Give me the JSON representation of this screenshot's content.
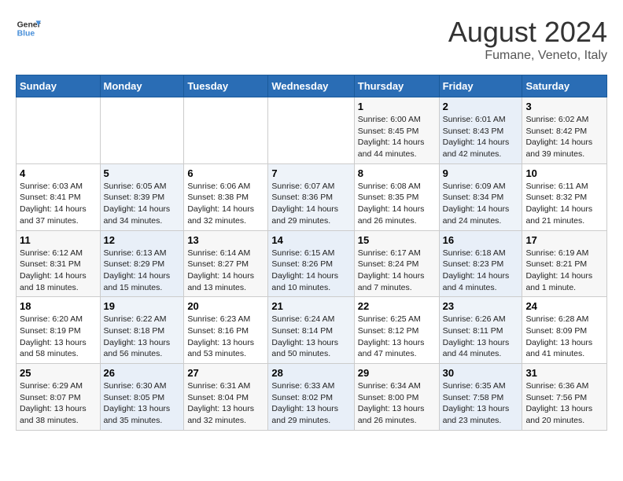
{
  "logo": {
    "text_general": "General",
    "text_blue": "Blue"
  },
  "title": "August 2024",
  "subtitle": "Fumane, Veneto, Italy",
  "header_days": [
    "Sunday",
    "Monday",
    "Tuesday",
    "Wednesday",
    "Thursday",
    "Friday",
    "Saturday"
  ],
  "weeks": [
    [
      {
        "day": "",
        "info": ""
      },
      {
        "day": "",
        "info": ""
      },
      {
        "day": "",
        "info": ""
      },
      {
        "day": "",
        "info": ""
      },
      {
        "day": "1",
        "info": "Sunrise: 6:00 AM\nSunset: 8:45 PM\nDaylight: 14 hours and 44 minutes."
      },
      {
        "day": "2",
        "info": "Sunrise: 6:01 AM\nSunset: 8:43 PM\nDaylight: 14 hours and 42 minutes."
      },
      {
        "day": "3",
        "info": "Sunrise: 6:02 AM\nSunset: 8:42 PM\nDaylight: 14 hours and 39 minutes."
      }
    ],
    [
      {
        "day": "4",
        "info": "Sunrise: 6:03 AM\nSunset: 8:41 PM\nDaylight: 14 hours and 37 minutes."
      },
      {
        "day": "5",
        "info": "Sunrise: 6:05 AM\nSunset: 8:39 PM\nDaylight: 14 hours and 34 minutes."
      },
      {
        "day": "6",
        "info": "Sunrise: 6:06 AM\nSunset: 8:38 PM\nDaylight: 14 hours and 32 minutes."
      },
      {
        "day": "7",
        "info": "Sunrise: 6:07 AM\nSunset: 8:36 PM\nDaylight: 14 hours and 29 minutes."
      },
      {
        "day": "8",
        "info": "Sunrise: 6:08 AM\nSunset: 8:35 PM\nDaylight: 14 hours and 26 minutes."
      },
      {
        "day": "9",
        "info": "Sunrise: 6:09 AM\nSunset: 8:34 PM\nDaylight: 14 hours and 24 minutes."
      },
      {
        "day": "10",
        "info": "Sunrise: 6:11 AM\nSunset: 8:32 PM\nDaylight: 14 hours and 21 minutes."
      }
    ],
    [
      {
        "day": "11",
        "info": "Sunrise: 6:12 AM\nSunset: 8:31 PM\nDaylight: 14 hours and 18 minutes."
      },
      {
        "day": "12",
        "info": "Sunrise: 6:13 AM\nSunset: 8:29 PM\nDaylight: 14 hours and 15 minutes."
      },
      {
        "day": "13",
        "info": "Sunrise: 6:14 AM\nSunset: 8:27 PM\nDaylight: 14 hours and 13 minutes."
      },
      {
        "day": "14",
        "info": "Sunrise: 6:15 AM\nSunset: 8:26 PM\nDaylight: 14 hours and 10 minutes."
      },
      {
        "day": "15",
        "info": "Sunrise: 6:17 AM\nSunset: 8:24 PM\nDaylight: 14 hours and 7 minutes."
      },
      {
        "day": "16",
        "info": "Sunrise: 6:18 AM\nSunset: 8:23 PM\nDaylight: 14 hours and 4 minutes."
      },
      {
        "day": "17",
        "info": "Sunrise: 6:19 AM\nSunset: 8:21 PM\nDaylight: 14 hours and 1 minute."
      }
    ],
    [
      {
        "day": "18",
        "info": "Sunrise: 6:20 AM\nSunset: 8:19 PM\nDaylight: 13 hours and 58 minutes."
      },
      {
        "day": "19",
        "info": "Sunrise: 6:22 AM\nSunset: 8:18 PM\nDaylight: 13 hours and 56 minutes."
      },
      {
        "day": "20",
        "info": "Sunrise: 6:23 AM\nSunset: 8:16 PM\nDaylight: 13 hours and 53 minutes."
      },
      {
        "day": "21",
        "info": "Sunrise: 6:24 AM\nSunset: 8:14 PM\nDaylight: 13 hours and 50 minutes."
      },
      {
        "day": "22",
        "info": "Sunrise: 6:25 AM\nSunset: 8:12 PM\nDaylight: 13 hours and 47 minutes."
      },
      {
        "day": "23",
        "info": "Sunrise: 6:26 AM\nSunset: 8:11 PM\nDaylight: 13 hours and 44 minutes."
      },
      {
        "day": "24",
        "info": "Sunrise: 6:28 AM\nSunset: 8:09 PM\nDaylight: 13 hours and 41 minutes."
      }
    ],
    [
      {
        "day": "25",
        "info": "Sunrise: 6:29 AM\nSunset: 8:07 PM\nDaylight: 13 hours and 38 minutes."
      },
      {
        "day": "26",
        "info": "Sunrise: 6:30 AM\nSunset: 8:05 PM\nDaylight: 13 hours and 35 minutes."
      },
      {
        "day": "27",
        "info": "Sunrise: 6:31 AM\nSunset: 8:04 PM\nDaylight: 13 hours and 32 minutes."
      },
      {
        "day": "28",
        "info": "Sunrise: 6:33 AM\nSunset: 8:02 PM\nDaylight: 13 hours and 29 minutes."
      },
      {
        "day": "29",
        "info": "Sunrise: 6:34 AM\nSunset: 8:00 PM\nDaylight: 13 hours and 26 minutes."
      },
      {
        "day": "30",
        "info": "Sunrise: 6:35 AM\nSunset: 7:58 PM\nDaylight: 13 hours and 23 minutes."
      },
      {
        "day": "31",
        "info": "Sunrise: 6:36 AM\nSunset: 7:56 PM\nDaylight: 13 hours and 20 minutes."
      }
    ]
  ]
}
